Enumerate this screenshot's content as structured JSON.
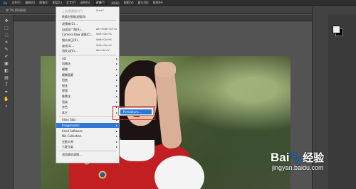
{
  "app": {
    "logo": "Ps"
  },
  "menubar": {
    "items": [
      "文件(F)",
      "编辑(E)",
      "图像(I)",
      "图层(L)",
      "文字(Y)",
      "选择(S)",
      "滤镜(T)",
      "3D(D)",
      "视图(V)",
      "窗口(W)",
      "帮助(H)"
    ],
    "active_index": 6
  },
  "optionsbar": {
    "text": "W 7% (RGB/8)"
  },
  "tabbar": {
    "title": ""
  },
  "filter_menu": {
    "items": [
      {
        "label": "上次滤镜操作(F)",
        "shortcut": "Ctrl+F",
        "disabled": true,
        "has_submenu": false
      },
      {
        "label": "转换为智能滤镜(S)",
        "shortcut": "",
        "disabled": false,
        "has_submenu": false
      },
      {
        "label": "滤镜库(G)...",
        "shortcut": "",
        "disabled": false,
        "has_submenu": false
      },
      {
        "label": "自适应广角(A)...",
        "shortcut": "Alt+Shift+Ctrl+A",
        "disabled": false,
        "has_submenu": false
      },
      {
        "label": "Camera Raw 滤镜(C)...",
        "shortcut": "Shift+Ctrl+A",
        "disabled": false,
        "has_submenu": false
      },
      {
        "label": "镜头校正(R)...",
        "shortcut": "Shift+Ctrl+R",
        "disabled": false,
        "has_submenu": false
      },
      {
        "label": "液化(L)...",
        "shortcut": "Shift+Ctrl+X",
        "disabled": false,
        "has_submenu": false
      },
      {
        "label": "消失点(V)...",
        "shortcut": "Alt+Ctrl+V",
        "disabled": false,
        "has_submenu": false
      },
      {
        "label": "3D",
        "shortcut": "",
        "disabled": false,
        "has_submenu": true
      },
      {
        "label": "风格化",
        "shortcut": "",
        "disabled": false,
        "has_submenu": true
      },
      {
        "label": "模糊",
        "shortcut": "",
        "disabled": false,
        "has_submenu": true
      },
      {
        "label": "模糊画廊",
        "shortcut": "",
        "disabled": false,
        "has_submenu": true
      },
      {
        "label": "扭曲",
        "shortcut": "",
        "disabled": false,
        "has_submenu": true
      },
      {
        "label": "锐化",
        "shortcut": "",
        "disabled": false,
        "has_submenu": true
      },
      {
        "label": "视频",
        "shortcut": "",
        "disabled": false,
        "has_submenu": true
      },
      {
        "label": "像素化",
        "shortcut": "",
        "disabled": false,
        "has_submenu": true
      },
      {
        "label": "渲染",
        "shortcut": "",
        "disabled": false,
        "has_submenu": true
      },
      {
        "label": "杂色",
        "shortcut": "",
        "disabled": false,
        "has_submenu": true
      },
      {
        "label": "其它",
        "shortcut": "",
        "disabled": false,
        "has_submenu": true
      },
      {
        "label": "Alien Skin",
        "shortcut": "",
        "disabled": false,
        "has_submenu": true
      },
      {
        "label": "Imagenomic",
        "shortcut": "",
        "disabled": false,
        "has_submenu": true,
        "highlighted": true
      },
      {
        "label": "Knoll Software",
        "shortcut": "",
        "disabled": false,
        "has_submenu": true
      },
      {
        "label": "Nik Collection",
        "shortcut": "",
        "disabled": false,
        "has_submenu": true
      },
      {
        "label": "光影大师",
        "shortcut": "",
        "disabled": false,
        "has_submenu": true
      },
      {
        "label": "七夏兄弟",
        "shortcut": "",
        "disabled": false,
        "has_submenu": true
      },
      {
        "label": "浏览联机滤镜...",
        "shortcut": "",
        "disabled": false,
        "has_submenu": false
      }
    ]
  },
  "submenu": {
    "item": "Portraiture..."
  },
  "watermark": {
    "brand_prefix": "Bai",
    "brand_suffix": "经验",
    "url": "jingyan.baidu.com"
  },
  "colors": {
    "highlight": "#2f78d8",
    "callout": "#e62020",
    "brand": "#2f5fd0"
  }
}
